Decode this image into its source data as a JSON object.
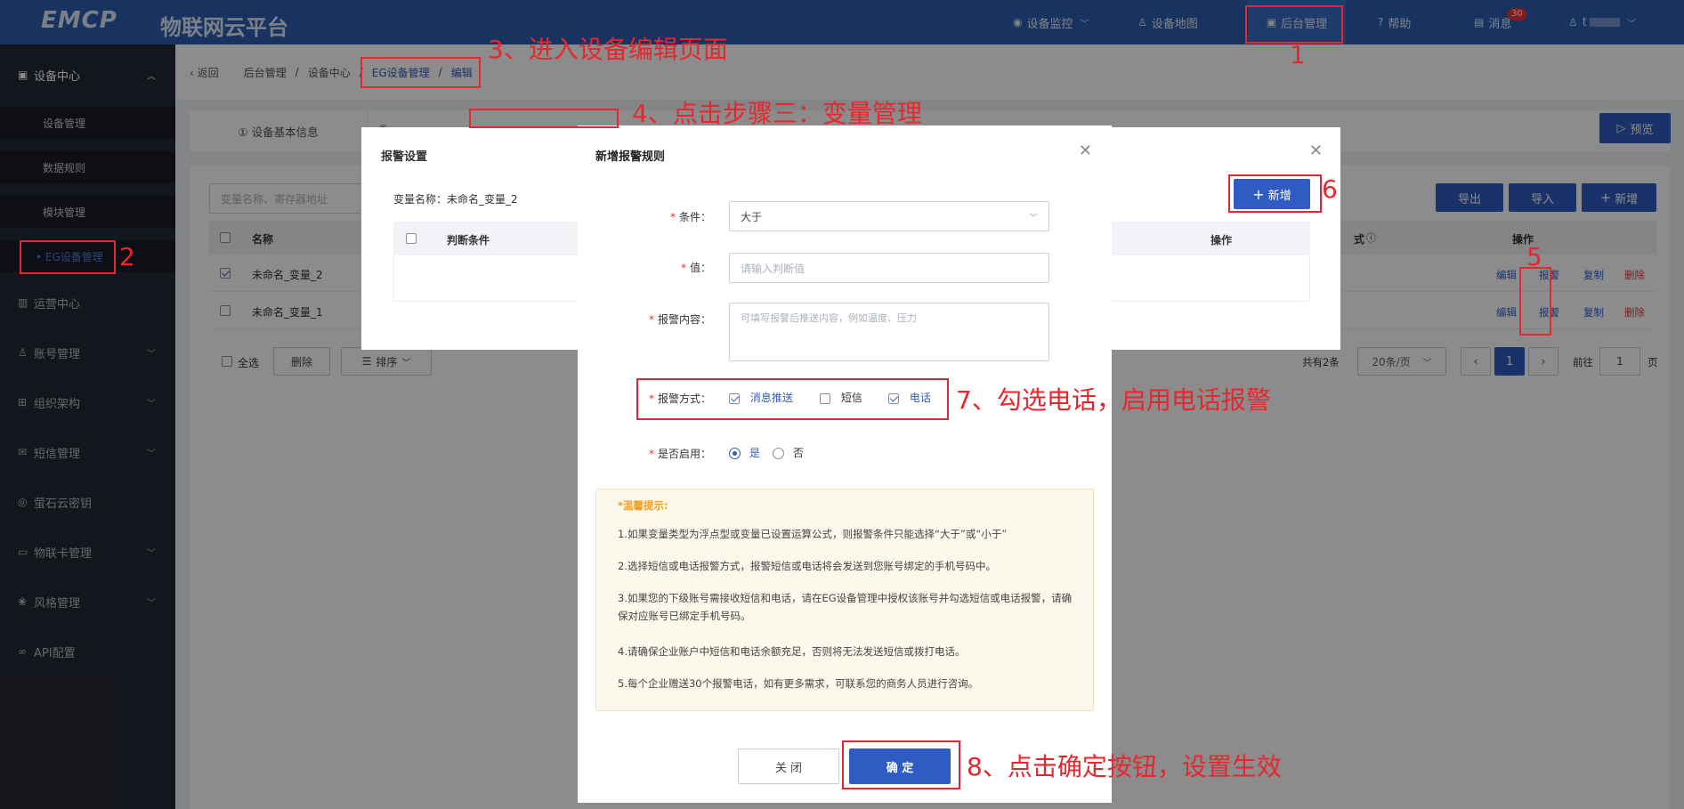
{
  "header": {
    "logo": "EMCP",
    "brand": "物联网云平台",
    "nav": [
      {
        "label": "设备监控",
        "icon": "location-icon"
      },
      {
        "label": "设备地图",
        "icon": "user-icon"
      },
      {
        "label": "后台管理",
        "icon": "monitor-icon"
      },
      {
        "label": "帮助",
        "icon": "question-icon"
      },
      {
        "label": "消息",
        "icon": "message-icon"
      },
      {
        "label": "t",
        "icon": "user-icon"
      }
    ],
    "message_count": "30"
  },
  "sidebar": {
    "sections": [
      {
        "label": "设备中心",
        "icon": "monitor-icon"
      },
      {
        "label": "运营中心",
        "icon": "chart-icon"
      },
      {
        "label": "账号管理",
        "icon": "user-icon"
      },
      {
        "label": "组织架构",
        "icon": "org-icon"
      },
      {
        "label": "短信管理",
        "icon": "message-icon"
      },
      {
        "label": "萤石云密钥",
        "icon": "key-icon"
      },
      {
        "label": "物联卡管理",
        "icon": "card-icon"
      },
      {
        "label": "风格管理",
        "icon": "style-icon"
      },
      {
        "label": "API配置",
        "icon": "link-icon"
      }
    ],
    "sub_items": [
      "设备管理",
      "数据规则",
      "模块管理",
      "• EG设备管理"
    ]
  },
  "breadcrumb": {
    "back": "返回",
    "items": [
      "后台管理",
      "设备中心",
      "EG设备管理",
      "编辑"
    ],
    "sep": "/"
  },
  "steps": {
    "step1": "① 设备基本信息",
    "step2": "②"
  },
  "toolbar": {
    "preview": "预览",
    "search_placeholder": "变量名称、寄存器地址",
    "export": "导出",
    "import": "导入",
    "add": "新增"
  },
  "table": {
    "headers": {
      "name": "名称",
      "method": "式",
      "ops": "操作"
    },
    "rows": [
      {
        "name": "未命名_变量_2",
        "checked": true
      },
      {
        "name": "未命名_变量_1",
        "checked": false
      }
    ],
    "ops": {
      "edit": "编辑",
      "alarm": "报警",
      "copy": "复制",
      "delete": "删除"
    }
  },
  "footer": {
    "select_all": "全选",
    "delete": "删除",
    "sort": "排序",
    "total": "共有2条",
    "page_size": "20条/页",
    "current_page": "1",
    "goto_label": "前往",
    "goto_value": "1",
    "page_suffix": "页"
  },
  "alarm_dialog": {
    "title": "报警设置",
    "var_label": "变量名称：",
    "var_name": "未命名_变量_2",
    "add": "新增",
    "col_condition": "判断条件",
    "col_ops": "操作"
  },
  "rule_dialog": {
    "title": "新增报警规则",
    "fields": {
      "condition": {
        "label": "条件：",
        "value": "大于"
      },
      "value": {
        "label": "值：",
        "placeholder": "请输入判断值"
      },
      "content": {
        "label": "报警内容：",
        "placeholder": "可填写报警后推送内容，例如温度、压力"
      },
      "method": {
        "label": "报警方式：",
        "options": [
          {
            "label": "消息推送",
            "checked": true
          },
          {
            "label": "短信",
            "checked": false
          },
          {
            "label": "电话",
            "checked": true
          }
        ]
      },
      "enabled": {
        "label": "是否启用：",
        "yes": "是",
        "no": "否",
        "selected": "是"
      }
    },
    "tips_title": "*温馨提示:",
    "tips": [
      "1.如果变量类型为浮点型或变量已设置运算公式，则报警条件只能选择“大于”或“小于”",
      "2.选择短信或电话报警方式，报警短信或电话将会发送到您账号绑定的手机号码中。",
      "3.如果您的下级账号需接收短信和电话，请在EG设备管理中授权该账号并勾选短信或电话报警，请确保对应账号已绑定手机号码。",
      "4.请确保企业账户中短信和电话余额充足，否则将无法发送短信或拨打电话。",
      "5.每个企业赠送30个报警电话，如有更多需求，可联系您的商务人员进行咨询。"
    ],
    "close": "关 闭",
    "confirm": "确 定"
  },
  "annotations": {
    "a1": "1",
    "a2": "2",
    "a3": "3、进入设备编辑页面",
    "a4": "4、点击步骤三：变量管理",
    "a5": "5",
    "a6": "6",
    "a7": "7、勾选电话，启用电话报警",
    "a8": "8、点击确定按钮，设置生效"
  },
  "colors": {
    "header_bg": "#2c5db0",
    "sidebar_bg": "#242833",
    "primary": "#2f5cc2",
    "danger": "#e33",
    "annotation_red": "#e8262d"
  }
}
